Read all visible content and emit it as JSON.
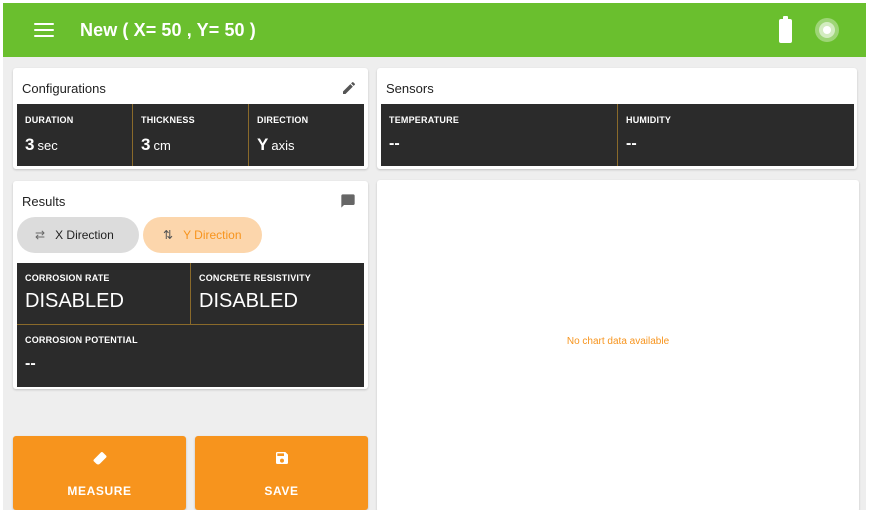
{
  "app_bar": {
    "title": "New ( X= 50 , Y= 50 )",
    "menu_icon": "hamburger-menu-icon",
    "battery_icon": "battery-full-icon",
    "connection_icon": "connection-status-icon",
    "color": "#6abf2e"
  },
  "configurations": {
    "title": "Configurations",
    "edit_icon": "pencil-icon",
    "duration": {
      "label": "DURATION",
      "value": "3",
      "unit": "sec"
    },
    "thickness": {
      "label": "THICKNESS",
      "value": "3",
      "unit": "cm"
    },
    "direction": {
      "label": "DIRECTION",
      "value": "Y",
      "unit": "axis"
    }
  },
  "sensors": {
    "title": "Sensors",
    "temperature": {
      "label": "TEMPERATURE",
      "value": "--"
    },
    "humidity": {
      "label": "HUMIDITY",
      "value": "--"
    }
  },
  "results": {
    "title": "Results",
    "comment_icon": "comment-icon",
    "tabs": [
      {
        "label": "X Direction",
        "icon": "swap-horizontal-icon",
        "selected": false
      },
      {
        "label": "Y Direction",
        "icon": "swap-vertical-icon",
        "selected": true
      }
    ],
    "corrosion_rate": {
      "label": "CORROSION RATE",
      "value": "DISABLED"
    },
    "concrete_resistivity": {
      "label": "CONCRETE RESISTIVITY",
      "value": "DISABLED"
    },
    "corrosion_potential": {
      "label": "CORROSION POTENTIAL",
      "value": "--"
    }
  },
  "chart": {
    "empty_message": "No chart data available"
  },
  "actions": {
    "measure": {
      "label": "MEASURE",
      "icon": "eraser-icon"
    },
    "save": {
      "label": "SAVE",
      "icon": "floppy-disk-icon"
    }
  },
  "colors": {
    "accent": "#f7941d",
    "dark_panel": "#2b2b2b",
    "selected_tab_bg": "#fcd6ac"
  }
}
